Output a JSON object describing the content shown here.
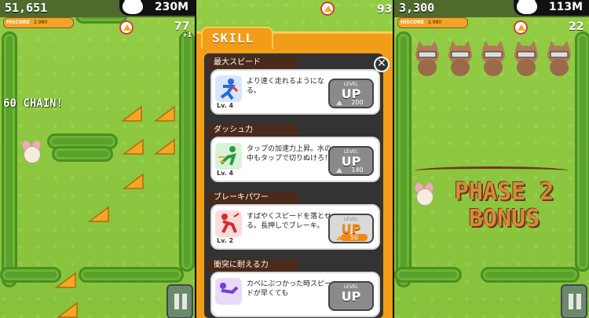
{
  "left_panel": {
    "score": "51,651",
    "distance": "230M",
    "hiscore_label": "HISCORE",
    "hiscore_value": "2,980",
    "cheese_count": "77",
    "cheese_bonus": "+1",
    "chain_text": "60 CHAIN!"
  },
  "middle_panel": {
    "cheese_count": "93",
    "skill_tab": "SKILL",
    "close_symbol": "✕",
    "skills": [
      {
        "title": "最大スピード",
        "desc": "より速く走れるようになる。",
        "level": "Lv. 4",
        "up_label": "UP",
        "level_label": "LEVEL",
        "cost": "200",
        "affordable": false,
        "icon_color": "#2a6ad8"
      },
      {
        "title": "ダッシュ力",
        "desc": "タップの加速力上昇。水の中もタップで切りぬけろ！",
        "level": "Lv. 4",
        "up_label": "UP",
        "level_label": "LEVEL",
        "cost": "140",
        "affordable": false,
        "icon_color": "#2a9a3a"
      },
      {
        "title": "ブレーキパワー",
        "desc": "すばやくスピードを落とせる。長押しでブレーキ。",
        "level": "Lv. 2",
        "up_label": "UP",
        "level_label": "LEVEL",
        "cost": "50",
        "affordable": true,
        "icon_color": "#d82a2a"
      },
      {
        "title": "衝突に耐える力",
        "desc": "カベにぶつかった時スピードが早くても",
        "level": "",
        "up_label": "UP",
        "level_label": "LEVEL",
        "cost": "",
        "affordable": false,
        "icon_color": "#7a3ad8"
      }
    ]
  },
  "right_panel": {
    "score": "3,300",
    "distance": "113M",
    "hiscore_label": "HISCORE",
    "hiscore_value": "2,980",
    "cheese_count": "22",
    "phase_line1": "PHASE 2",
    "phase_line2": "BONUS"
  },
  "colors": {
    "grass": "#8cc63f",
    "hedge": "#5aa12b",
    "menu_orange": "#f29d18",
    "cheese": "#f6a623"
  }
}
